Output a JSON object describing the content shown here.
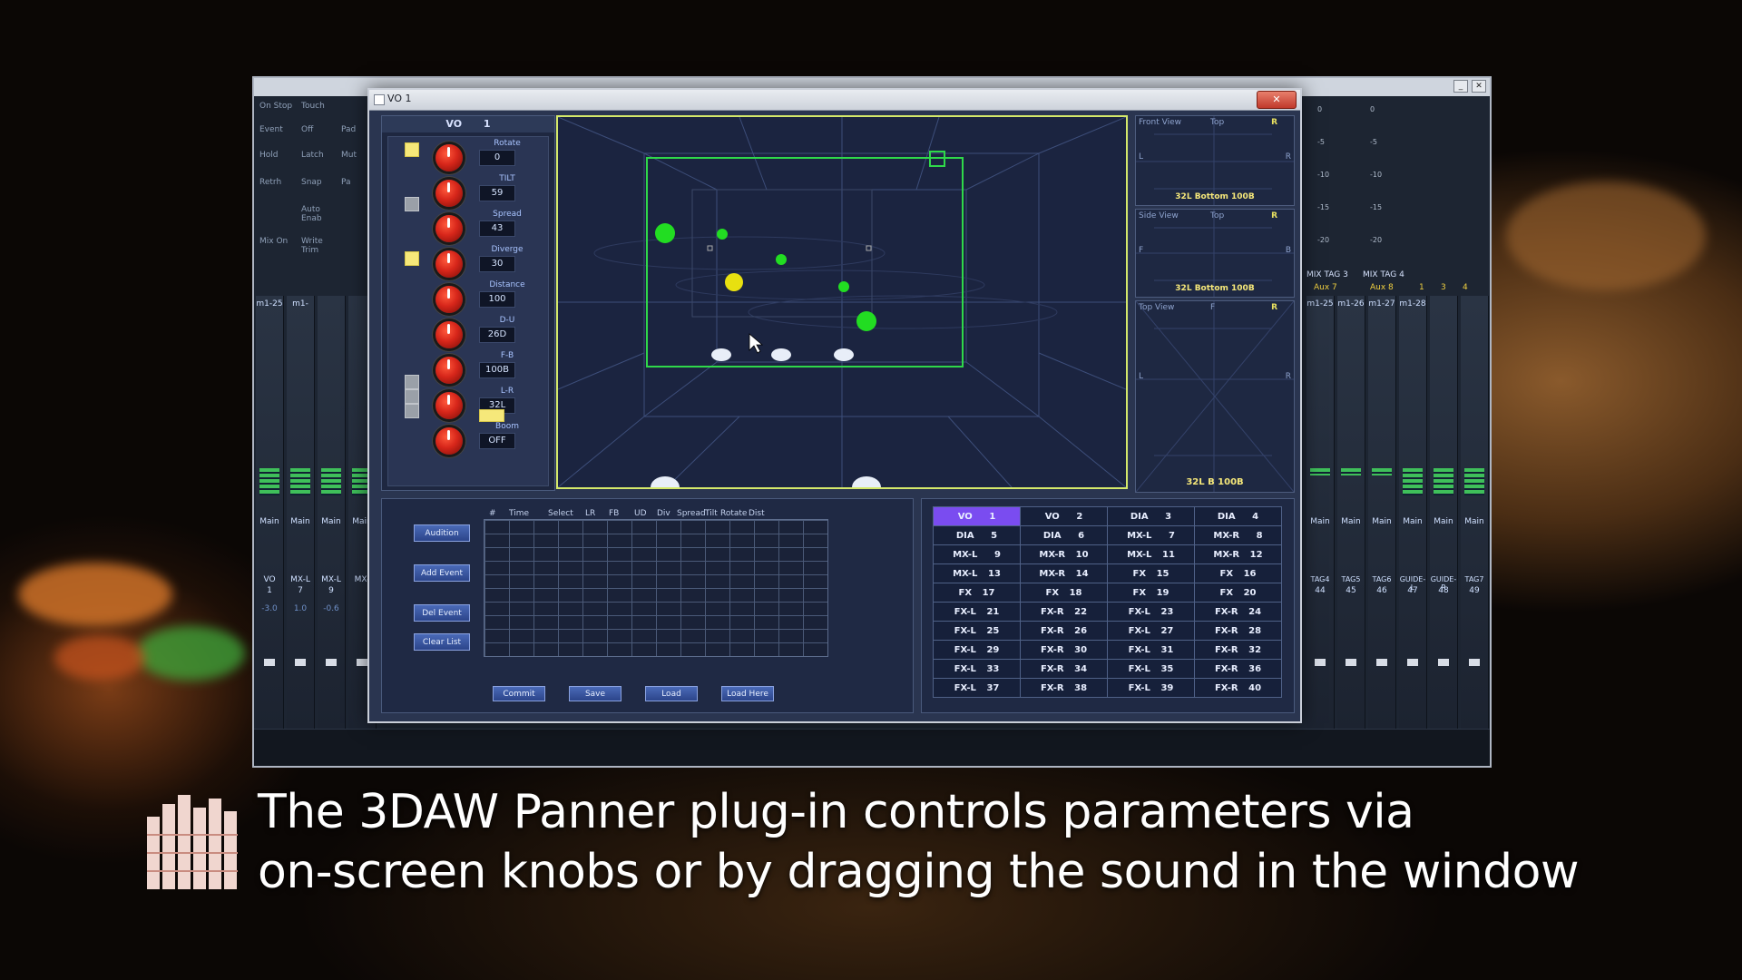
{
  "background_mixer": {
    "left_controls": [
      "On Stop",
      "Touch",
      "Event",
      "Off",
      "Pad",
      "Hold",
      "Latch",
      "Mut",
      "Retrh",
      "Snap",
      "Pa",
      "Auto Enab",
      "Mix On",
      "Write Trim"
    ],
    "strips_left": [
      {
        "label": "m1-25",
        "out": "Main",
        "name": "VO",
        "num": "1",
        "val": "-3.0"
      },
      {
        "label": "m1-",
        "out": "Main",
        "name": "MX-L",
        "num": "7",
        "val": "1.0"
      },
      {
        "label": "",
        "out": "Main",
        "name": "MX-L",
        "num": "9",
        "val": "-0.6"
      },
      {
        "label": "",
        "out": "Main",
        "name": "MX-",
        "num": "",
        "val": ""
      }
    ],
    "strips_right": [
      {
        "label": "m1-25",
        "out": "Main",
        "name": "TAG4",
        "num": "44"
      },
      {
        "label": "m1-26",
        "out": "Main",
        "name": "TAG5",
        "num": "45"
      },
      {
        "label": "m1-27",
        "out": "Main",
        "name": "TAG6",
        "num": "46"
      },
      {
        "label": "m1-28",
        "out": "Main",
        "name": "GUIDE-L",
        "num": "47"
      },
      {
        "label": "",
        "out": "Main",
        "name": "GUIDE-R",
        "num": "48"
      },
      {
        "label": "",
        "out": "Main",
        "name": "TAG7",
        "num": "49"
      }
    ],
    "mix_tags": [
      "MIX TAG 3",
      "MIX TAG 4"
    ],
    "aux": [
      "Aux 7",
      "Aux 8"
    ],
    "meter_scale": [
      "0",
      "-5",
      "-10",
      "-15",
      "-20"
    ],
    "bus_numbers": [
      "1",
      "3",
      "4"
    ]
  },
  "panner": {
    "window_title": "VO    1",
    "close_label": "✕",
    "head": {
      "name": "VO",
      "num": "1"
    },
    "knobs": [
      {
        "label": "Rotate",
        "value": "0"
      },
      {
        "label": "TILT",
        "value": "59"
      },
      {
        "label": "Spread",
        "value": "43"
      },
      {
        "label": "Diverge",
        "value": "30"
      },
      {
        "label": "Distance",
        "value": "100"
      },
      {
        "label": "D-U",
        "value": "26D"
      },
      {
        "label": "F-B",
        "value": "100B"
      },
      {
        "label": "L-R",
        "value": "32L"
      },
      {
        "label": "Boom",
        "value": "OFF"
      }
    ],
    "side_views": [
      {
        "title": "Front View",
        "top": "Top",
        "r": "R",
        "l": "L",
        "foot": "32L Bottom 100B"
      },
      {
        "title": "Side View",
        "top": "Top",
        "r": "R",
        "l": "F",
        "rb": "B",
        "foot": "32L Bottom 100B"
      },
      {
        "title": "Top View",
        "top": "F",
        "r": "R",
        "l": "L",
        "foot": "32L  B  100B"
      }
    ],
    "event_buttons": [
      "Audition",
      "Add Event",
      "Del Event",
      "Clear List"
    ],
    "event_columns": [
      "#",
      "Time",
      "Select",
      "LR",
      "FB",
      "UD",
      "Div",
      "Spread",
      "Tilt",
      "Rotate",
      "Dist"
    ],
    "bottom_buttons": [
      "Commit",
      "Save",
      "Load",
      "Load Here"
    ],
    "channels": [
      [
        {
          "name": "VO",
          "num": "1",
          "selected": true
        },
        {
          "name": "VO",
          "num": "2"
        },
        {
          "name": "DIA",
          "num": "3"
        },
        {
          "name": "DIA",
          "num": "4"
        }
      ],
      [
        {
          "name": "DIA",
          "num": "5"
        },
        {
          "name": "DIA",
          "num": "6"
        },
        {
          "name": "MX-L",
          "num": "7"
        },
        {
          "name": "MX-R",
          "num": "8"
        }
      ],
      [
        {
          "name": "MX-L",
          "num": "9"
        },
        {
          "name": "MX-R",
          "num": "10"
        },
        {
          "name": "MX-L",
          "num": "11"
        },
        {
          "name": "MX-R",
          "num": "12"
        }
      ],
      [
        {
          "name": "MX-L",
          "num": "13"
        },
        {
          "name": "MX-R",
          "num": "14"
        },
        {
          "name": "FX",
          "num": "15"
        },
        {
          "name": "FX",
          "num": "16"
        }
      ],
      [
        {
          "name": "FX",
          "num": "17"
        },
        {
          "name": "FX",
          "num": "18"
        },
        {
          "name": "FX",
          "num": "19"
        },
        {
          "name": "FX",
          "num": "20"
        }
      ],
      [
        {
          "name": "FX-L",
          "num": "21"
        },
        {
          "name": "FX-R",
          "num": "22"
        },
        {
          "name": "FX-L",
          "num": "23"
        },
        {
          "name": "FX-R",
          "num": "24"
        }
      ],
      [
        {
          "name": "FX-L",
          "num": "25"
        },
        {
          "name": "FX-R",
          "num": "26"
        },
        {
          "name": "FX-L",
          "num": "27"
        },
        {
          "name": "FX-R",
          "num": "28"
        }
      ],
      [
        {
          "name": "FX-L",
          "num": "29"
        },
        {
          "name": "FX-R",
          "num": "30"
        },
        {
          "name": "FX-L",
          "num": "31"
        },
        {
          "name": "FX-R",
          "num": "32"
        }
      ],
      [
        {
          "name": "FX-L",
          "num": "33"
        },
        {
          "name": "FX-R",
          "num": "34"
        },
        {
          "name": "FX-L",
          "num": "35"
        },
        {
          "name": "FX-R",
          "num": "36"
        }
      ],
      [
        {
          "name": "FX-L",
          "num": "37"
        },
        {
          "name": "FX-R",
          "num": "38"
        },
        {
          "name": "FX-L",
          "num": "39"
        },
        {
          "name": "FX-R",
          "num": "40"
        }
      ]
    ]
  },
  "caption": {
    "line1": "The 3DAW Panner plug-in controls parameters via",
    "line2": "on-screen knobs or by dragging the sound in the window"
  },
  "colors": {
    "accent_frame": "#d4e86a",
    "selected_channel": "#7a4cf0",
    "knob_red": "#d7261a",
    "source_green": "#22dd22",
    "source_yellow": "#e8e010"
  }
}
